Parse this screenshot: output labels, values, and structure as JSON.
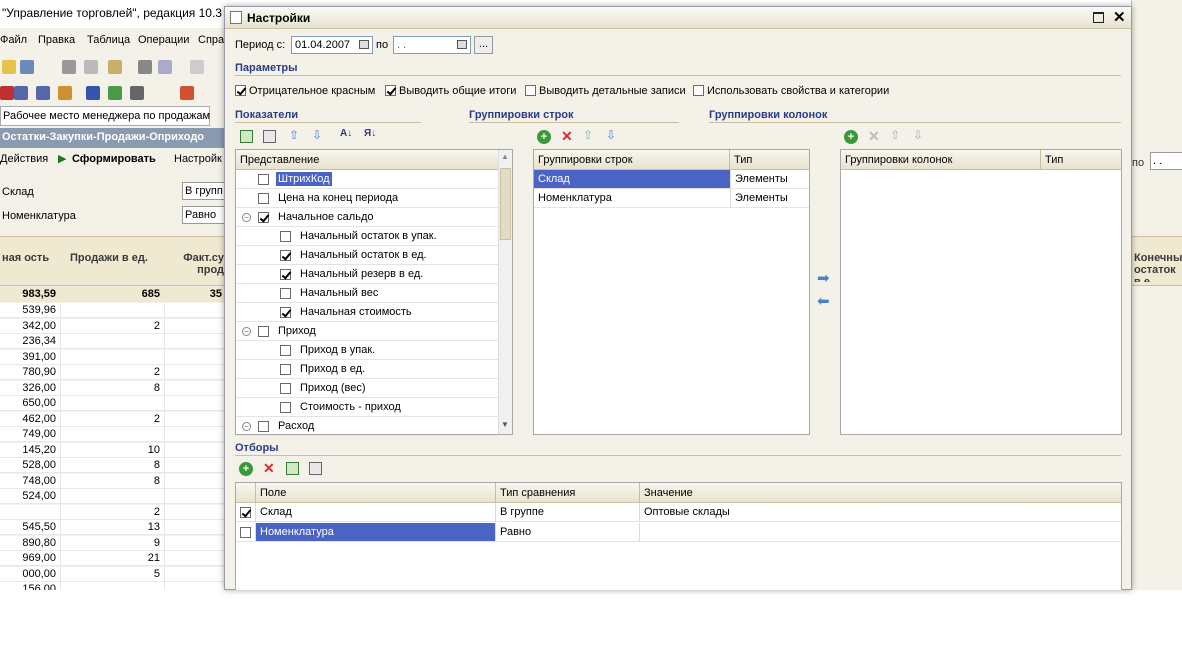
{
  "bg": {
    "title": "\"Управление торговлей\", редакция 10.3",
    "menu": [
      "Файл",
      "Правка",
      "Таблица",
      "Операции",
      "Спра"
    ],
    "tab": "Рабочее место менеджера по продажам",
    "report_title": "Остатки-Закупки-Продажи-Оприходо",
    "actions": "Действия",
    "form_btn": "Сформировать",
    "settings_btn": "Настройк",
    "filters": [
      {
        "label": "Склад",
        "value": "В групп"
      },
      {
        "label": "Номенклатура",
        "value": "Равно"
      }
    ],
    "col1": "ная ость",
    "col2": "Продажи в ед.",
    "col3": "Факт.су прод",
    "total": [
      "983,59",
      "685",
      "35"
    ],
    "rows": [
      [
        "539,96",
        ""
      ],
      [
        "342,00",
        "2"
      ],
      [
        "236,34",
        ""
      ],
      [
        "391,00",
        ""
      ],
      [
        "780,90",
        "2"
      ],
      [
        "326,00",
        "8"
      ],
      [
        "650,00",
        ""
      ],
      [
        "462,00",
        "2"
      ],
      [
        "749,00",
        ""
      ],
      [
        "145,20",
        "10"
      ],
      [
        "528,00",
        "8"
      ],
      [
        "748,00",
        "8"
      ],
      [
        "524,00",
        ""
      ],
      [
        "",
        "2"
      ],
      [
        "545,50",
        "13"
      ],
      [
        "890,80",
        "9"
      ],
      [
        "969,00",
        "21"
      ],
      [
        "000,00",
        "5"
      ],
      [
        "156,00",
        ""
      ]
    ],
    "right_col": "Конечны остаток в е",
    "right_po": "по"
  },
  "dlg": {
    "title": "Настройки",
    "period_label": "Период с:",
    "date_from": "01.04.2007",
    "po": "по",
    "date_to": ". .",
    "more": "...",
    "params_title": "Параметры",
    "params": [
      {
        "label": "Отрицательное красным",
        "checked": true
      },
      {
        "label": "Выводить общие итоги",
        "checked": true
      },
      {
        "label": "Выводить детальные записи",
        "checked": false
      },
      {
        "label": "Использовать свойства и категории",
        "checked": false
      }
    ],
    "indicators_title": "Показатели",
    "row_groups_title": "Группировки строк",
    "col_groups_title": "Группировки колонок",
    "ind_header": "Представление",
    "indicators": [
      {
        "label": "ШтрихКод",
        "checked": false,
        "level": 0,
        "sel": true
      },
      {
        "label": "Цена на конец периода",
        "checked": false,
        "level": 0
      },
      {
        "label": "Начальное сальдо",
        "checked": true,
        "level": 0,
        "group": true
      },
      {
        "label": "Начальный остаток в упак.",
        "checked": false,
        "level": 1
      },
      {
        "label": "Начальный остаток в ед.",
        "checked": true,
        "level": 1
      },
      {
        "label": "Начальный резерв в ед.",
        "checked": true,
        "level": 1
      },
      {
        "label": "Начальный вес",
        "checked": false,
        "level": 1
      },
      {
        "label": "Начальная стоимость",
        "checked": true,
        "level": 1
      },
      {
        "label": "Приход",
        "checked": false,
        "level": 0,
        "group": true
      },
      {
        "label": "Приход в упак.",
        "checked": false,
        "level": 1
      },
      {
        "label": "Приход в ед.",
        "checked": false,
        "level": 1
      },
      {
        "label": "Приход (вес)",
        "checked": false,
        "level": 1
      },
      {
        "label": "Стоимость - приход",
        "checked": false,
        "level": 1
      },
      {
        "label": "Расход",
        "checked": false,
        "level": 0,
        "group": true
      }
    ],
    "rg_header": "Группировки строк",
    "rg_type": "Тип",
    "row_groups": [
      {
        "name": "Склад",
        "type": "Элементы"
      },
      {
        "name": "Номенклатура",
        "type": "Элементы"
      }
    ],
    "cg_header": "Группировки колонок",
    "cg_type": "Тип",
    "filters_title": "Отборы",
    "f_field": "Поле",
    "f_cmp": "Тип сравнения",
    "f_val": "Значение",
    "filters": [
      {
        "field": "Склад",
        "cmp": "В группе",
        "value": "Оптовые склады",
        "checked": true
      },
      {
        "field": "Номенклатура",
        "cmp": "Равно",
        "value": "",
        "checked": false
      }
    ]
  }
}
